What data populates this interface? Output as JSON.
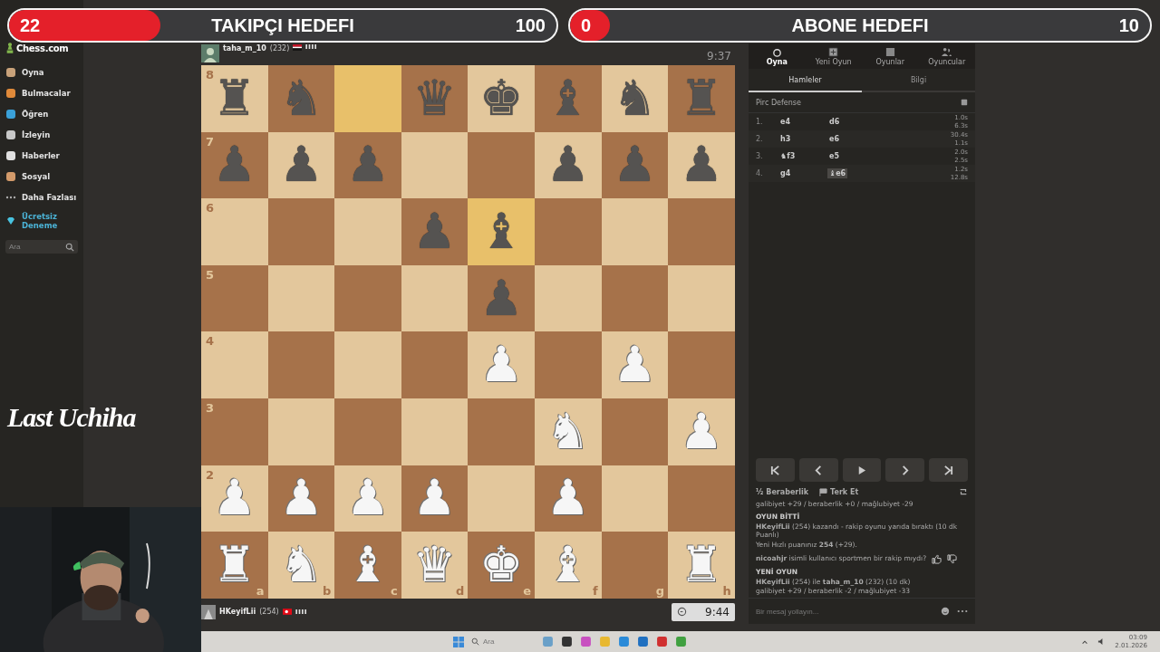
{
  "goals": [
    {
      "count": "22",
      "label": "TAKIPÇI HEDEFI",
      "target": "100",
      "level": 0.22
    },
    {
      "count": "0",
      "label": "ABONE HEDEFI",
      "target": "10",
      "level": 0
    }
  ],
  "sidebar": {
    "logo": "Chess.com",
    "items": [
      {
        "label": "Oyna",
        "kind": "nav"
      },
      {
        "label": "Bulmacalar",
        "kind": "nav"
      },
      {
        "label": "Öğren",
        "kind": "nav"
      },
      {
        "label": "İzleyin",
        "kind": "nav"
      },
      {
        "label": "Haberler",
        "kind": "nav"
      },
      {
        "label": "Sosyal",
        "kind": "nav"
      },
      {
        "label": "Daha Fazlası",
        "kind": "nav"
      },
      {
        "label": "Ücretsiz Deneme",
        "kind": "promo"
      }
    ],
    "search": {
      "placeholder": "Ara"
    }
  },
  "top_player": {
    "name": "taha_m_10",
    "rating": "(232)",
    "clock": "9:37"
  },
  "bottom_player": {
    "name": "HKeyifLii",
    "rating": "(254)",
    "clock": "9:44"
  },
  "board": {
    "files": [
      "a",
      "b",
      "c",
      "d",
      "e",
      "f",
      "g",
      "h"
    ],
    "ranks": [
      {
        "label": "8",
        "squares": [
          {
            "piece": "♜",
            "white": false,
            "highlighted": false
          },
          {
            "piece": "♞",
            "white": false,
            "highlighted": false
          },
          {
            "highlighted": true
          },
          {
            "piece": "♛",
            "white": false,
            "highlighted": false
          },
          {
            "piece": "♚",
            "white": false,
            "highlighted": false
          },
          {
            "piece": "♝",
            "white": false,
            "highlighted": false
          },
          {
            "piece": "♞",
            "white": false,
            "highlighted": false
          },
          {
            "piece": "♜",
            "white": false,
            "highlighted": false
          }
        ]
      },
      {
        "label": "7",
        "squares": [
          {
            "piece": "♟",
            "white": false,
            "highlighted": false
          },
          {
            "piece": "♟",
            "white": false,
            "highlighted": false
          },
          {
            "piece": "♟",
            "white": false,
            "highlighted": false
          },
          {
            "highlighted": false
          },
          {
            "highlighted": false
          },
          {
            "piece": "♟",
            "white": false,
            "highlighted": false
          },
          {
            "piece": "♟",
            "white": false,
            "highlighted": false
          },
          {
            "piece": "♟",
            "white": false,
            "highlighted": false
          }
        ]
      },
      {
        "label": "6",
        "squares": [
          {
            "highlighted": false
          },
          {
            "highlighted": false
          },
          {
            "highlighted": false
          },
          {
            "piece": "♟",
            "white": false,
            "highlighted": false
          },
          {
            "piece": "♝",
            "white": false,
            "highlighted": true
          },
          {
            "highlighted": false
          },
          {
            "highlighted": false
          },
          {
            "highlighted": false
          }
        ]
      },
      {
        "label": "5",
        "squares": [
          {
            "highlighted": false
          },
          {
            "highlighted": false
          },
          {
            "highlighted": false
          },
          {
            "highlighted": false
          },
          {
            "piece": "♟",
            "white": false,
            "highlighted": false
          },
          {
            "highlighted": false
          },
          {
            "highlighted": false
          },
          {
            "highlighted": false
          }
        ]
      },
      {
        "label": "4",
        "squares": [
          {
            "highlighted": false
          },
          {
            "highlighted": false
          },
          {
            "highlighted": false
          },
          {
            "highlighted": false
          },
          {
            "piece": "♟",
            "white": true,
            "highlighted": false
          },
          {
            "highlighted": false
          },
          {
            "piece": "♟",
            "white": true,
            "highlighted": false
          },
          {
            "highlighted": false
          }
        ]
      },
      {
        "label": "3",
        "squares": [
          {
            "highlighted": false
          },
          {
            "highlighted": false
          },
          {
            "highlighted": false
          },
          {
            "highlighted": false
          },
          {
            "highlighted": false
          },
          {
            "piece": "♞",
            "white": true,
            "highlighted": false
          },
          {
            "highlighted": false
          },
          {
            "piece": "♟",
            "white": true,
            "highlighted": false
          }
        ]
      },
      {
        "label": "2",
        "squares": [
          {
            "piece": "♟",
            "white": true,
            "highlighted": false
          },
          {
            "piece": "♟",
            "white": true,
            "highlighted": false
          },
          {
            "piece": "♟",
            "white": true,
            "highlighted": false
          },
          {
            "piece": "♟",
            "white": true,
            "highlighted": false
          },
          {
            "highlighted": false
          },
          {
            "piece": "♟",
            "white": true,
            "highlighted": false
          },
          {
            "highlighted": false
          },
          {
            "highlighted": false
          }
        ]
      },
      {
        "squares": [
          {
            "piece": "♜",
            "white": true,
            "highlighted": false
          },
          {
            "piece": "♞",
            "white": true,
            "highlighted": false
          },
          {
            "piece": "♝",
            "white": true,
            "highlighted": false
          },
          {
            "piece": "♛",
            "white": true,
            "highlighted": false
          },
          {
            "piece": "♚",
            "white": true,
            "highlighted": false
          },
          {
            "piece": "♝",
            "white": true,
            "highlighted": false
          },
          {
            "highlighted": false
          },
          {
            "piece": "♜",
            "white": true,
            "highlighted": false
          }
        ]
      }
    ]
  },
  "panel": {
    "tabs": [
      {
        "label": "Oyna",
        "selected": true
      },
      {
        "label": "Yeni Oyun",
        "selected": false
      },
      {
        "label": "Oyunlar",
        "selected": false
      },
      {
        "label": "Oyuncular",
        "selected": false
      }
    ],
    "subtabs": [
      {
        "label": "Hamleler",
        "selected": true
      },
      {
        "label": "Bilgi",
        "selected": false
      }
    ],
    "opening": "Pirc Defense",
    "moves": [
      {
        "number": "1.",
        "white": {
          "san": "e4",
          "selected": false
        },
        "black": {
          "san": "d6",
          "selected": false
        },
        "times": [
          "1.0s",
          "6.3s"
        ]
      },
      {
        "number": "2.",
        "white": {
          "san": "h3",
          "selected": false
        },
        "black": {
          "san": "e6",
          "selected": false
        },
        "times": [
          "30.4s",
          "1.1s"
        ]
      },
      {
        "number": "3.",
        "white": {
          "piece": "♞",
          "san": "f3",
          "selected": false
        },
        "black": {
          "san": "e5",
          "selected": false
        },
        "times": [
          "2.0s",
          "2.5s"
        ]
      },
      {
        "number": "4.",
        "white": {
          "san": "g4",
          "selected": false
        },
        "black": {
          "piece": "♝",
          "san": "e6",
          "selected": true
        },
        "times": [
          "1.2s",
          "12.8s"
        ]
      }
    ],
    "actions": [
      {
        "icon": "½",
        "label": "Beraberlik"
      },
      {
        "label": "Terk Et"
      }
    ],
    "chat": [
      {
        "kind": "text",
        "text": "galibiyet +29 / beraberlik +0 / mağlubiyet -29"
      },
      {
        "kind": "heading",
        "text": "OYUN BİTTİ"
      },
      {
        "kind": "text",
        "text": "**HKeyifLii** (254) kazandı - rakip oyunu yarıda bıraktı (10 dk Puanlı)"
      },
      {
        "kind": "text",
        "text": "Yeni Hızlı puanınız **254** (+29)."
      },
      {
        "kind": "feedback",
        "text": "**nicoahjr** isimli kullanıcı sportmen bir rakip mıydı?"
      },
      {
        "kind": "heading",
        "text": "YENİ OYUN"
      },
      {
        "kind": "text",
        "text": "**HKeyifLii** (254) ile **taha_m_10** (232) (10 dk)"
      },
      {
        "kind": "text",
        "text": "galibiyet +29 / beraberlik -2 / mağlubiyet -33"
      }
    ],
    "message": {
      "placeholder": "Bir mesaj yollayın..."
    }
  },
  "overlay_logo": "Last Uchiha",
  "taskbar": {
    "search": {
      "placeholder": "Ara"
    },
    "time": "03:09",
    "date": "2.01.2026"
  }
}
